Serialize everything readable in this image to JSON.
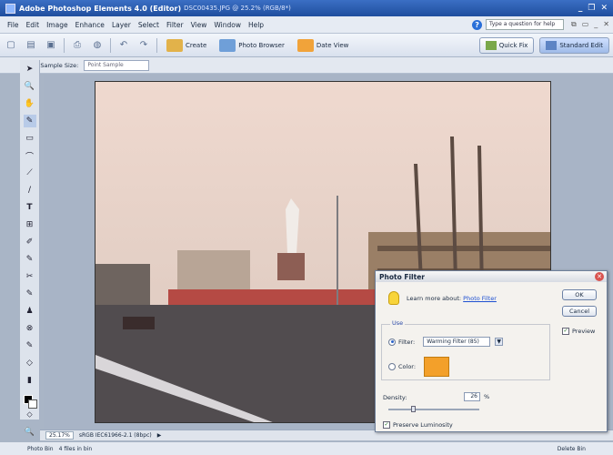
{
  "window": {
    "title": "Adobe Photoshop Elements 4.0 (Editor)",
    "title_extra": "DSC00435.JPG @ 25.2% (RGB/8*)",
    "controls": [
      "_",
      "❐",
      "✕"
    ]
  },
  "menu": {
    "items": [
      "File",
      "Edit",
      "Image",
      "Enhance",
      "Layer",
      "Select",
      "Filter",
      "View",
      "Window",
      "Help"
    ],
    "help_search_placeholder": "Type a question for help",
    "mdi_controls": [
      "⧉",
      "▭",
      "_",
      "✕"
    ]
  },
  "toolbar": {
    "create_label": "Create",
    "photo_browser_label": "Photo Browser",
    "date_view_label": "Date View",
    "quick_fix_label": "Quick Fix",
    "standard_edit_label": "Standard Edit"
  },
  "options_bar": {
    "sample_size_label": "Sample Size:",
    "sample_size_value": "Point Sample"
  },
  "tools": [
    "➤",
    "🔍",
    "✋",
    "✎",
    "▭",
    "⌒",
    "⟋",
    "∕",
    "T",
    "⊞",
    "✐",
    "✎",
    "✂",
    "✎",
    "♟",
    "⊗",
    "✎",
    "◇",
    "▮",
    "⊂",
    "⬦",
    "🔍"
  ],
  "status": {
    "zoom": "25.17%",
    "profile": "sRGB IEC61966-2.1 (8bpc)",
    "arrow": "▶"
  },
  "photo_bin": {
    "label": "Photo Bin",
    "files": "4 files in bin",
    "delete_label": "Delete Bin"
  },
  "photo_filter_dialog": {
    "title": "Photo Filter",
    "learn_prefix": "Learn more about:",
    "learn_link": "Photo Filter",
    "use_legend": "Use",
    "filter_label": "Filter:",
    "filter_value": "Warming Filter (85)",
    "color_label": "Color:",
    "color_value": "#f3a02a",
    "density_label": "Density:",
    "density_value": "26",
    "density_unit": "%",
    "density_level_percent": 26,
    "preserve_label": "Preserve Luminosity",
    "ok_label": "OK",
    "cancel_label": "Cancel",
    "preview_label": "Preview"
  }
}
